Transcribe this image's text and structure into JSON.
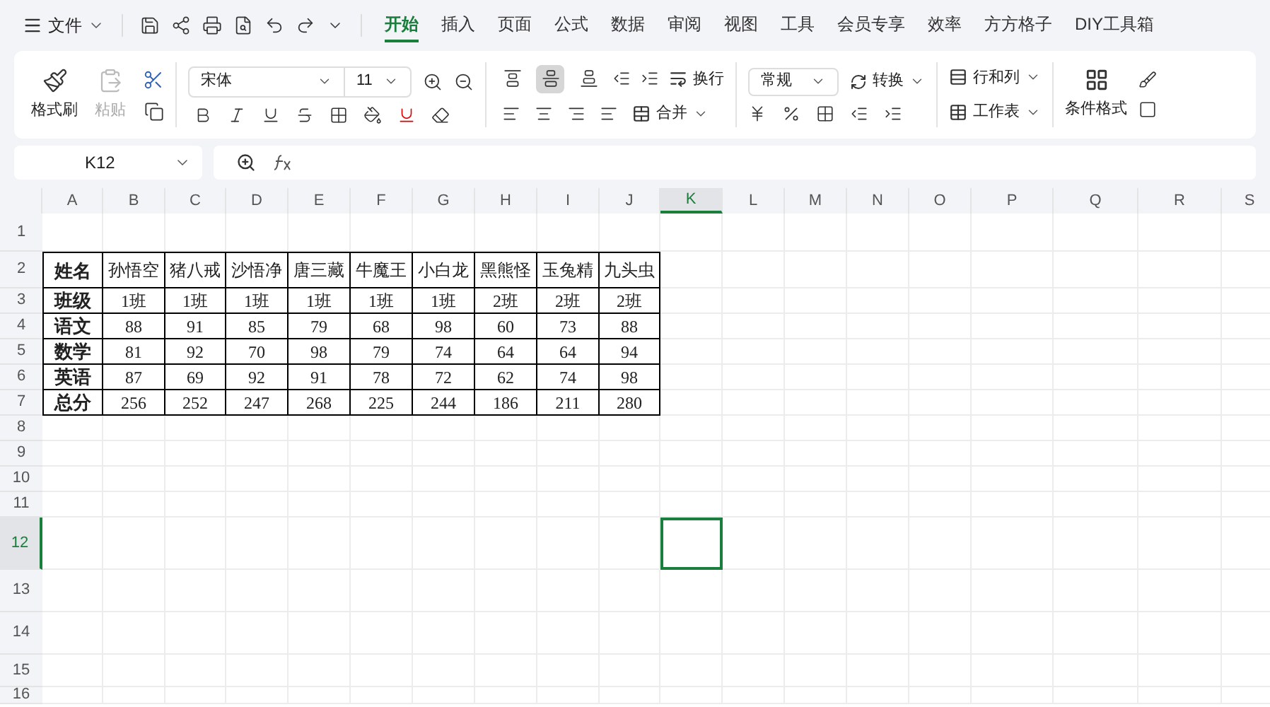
{
  "menu": {
    "label": "文件"
  },
  "tabs": [
    {
      "label": "开始",
      "selected": true
    },
    {
      "label": "插入",
      "selected": false
    },
    {
      "label": "页面",
      "selected": false
    },
    {
      "label": "公式",
      "selected": false
    },
    {
      "label": "数据",
      "selected": false
    },
    {
      "label": "审阅",
      "selected": false
    },
    {
      "label": "视图",
      "selected": false
    },
    {
      "label": "工具",
      "selected": false
    },
    {
      "label": "会员专享",
      "selected": false
    },
    {
      "label": "效率",
      "selected": false
    },
    {
      "label": "方方格子",
      "selected": false
    },
    {
      "label": "DIY工具箱",
      "selected": false
    }
  ],
  "ribbon": {
    "format_painter": "格式刷",
    "paste": {
      "label": "粘贴",
      "disabled": true
    },
    "font_name": "宋体",
    "font_size": "11",
    "vertical_align": [
      {
        "selected": false
      },
      {
        "selected": true
      },
      {
        "selected": false
      }
    ],
    "wrap": "换行",
    "merge": "合并",
    "number_format": "常规",
    "convert": "转换",
    "rows_columns": "行和列",
    "worksheet": "工作表",
    "conditional_format": "条件格式"
  },
  "name_box": "K12",
  "columns": [
    {
      "label": "A",
      "selected": false
    },
    {
      "label": "B",
      "selected": false
    },
    {
      "label": "C",
      "selected": false
    },
    {
      "label": "D",
      "selected": false
    },
    {
      "label": "E",
      "selected": false
    },
    {
      "label": "F",
      "selected": false
    },
    {
      "label": "G",
      "selected": false
    },
    {
      "label": "H",
      "selected": false
    },
    {
      "label": "I",
      "selected": false
    },
    {
      "label": "J",
      "selected": false
    },
    {
      "label": "K",
      "selected": true
    },
    {
      "label": "L",
      "selected": false
    },
    {
      "label": "M",
      "selected": false
    },
    {
      "label": "N",
      "selected": false
    },
    {
      "label": "O",
      "selected": false
    },
    {
      "label": "P",
      "selected": false
    },
    {
      "label": "Q",
      "selected": false
    },
    {
      "label": "R",
      "selected": false
    },
    {
      "label": "S",
      "selected": false
    }
  ],
  "rows": [
    {
      "label": "1",
      "selected": false
    },
    {
      "label": "2",
      "selected": false
    },
    {
      "label": "3",
      "selected": false
    },
    {
      "label": "4",
      "selected": false
    },
    {
      "label": "5",
      "selected": false
    },
    {
      "label": "6",
      "selected": false
    },
    {
      "label": "7",
      "selected": false
    },
    {
      "label": "8",
      "selected": false
    },
    {
      "label": "9",
      "selected": false
    },
    {
      "label": "10",
      "selected": false
    },
    {
      "label": "11",
      "selected": false
    },
    {
      "label": "12",
      "selected": true
    },
    {
      "label": "13",
      "selected": false
    },
    {
      "label": "14",
      "selected": false
    },
    {
      "label": "15",
      "selected": false
    },
    {
      "label": "16",
      "selected": false
    }
  ],
  "table": [
    [
      "姓名",
      "孙悟空",
      "猪八戒",
      "沙悟净",
      "唐三藏",
      "牛魔王",
      "小白龙",
      "黑熊怪",
      "玉兔精",
      "九头虫"
    ],
    [
      "班级",
      "1班",
      "1班",
      "1班",
      "1班",
      "1班",
      "1班",
      "2班",
      "2班",
      "2班"
    ],
    [
      "语文",
      "88",
      "91",
      "85",
      "79",
      "68",
      "98",
      "60",
      "73",
      "88"
    ],
    [
      "数学",
      "81",
      "92",
      "70",
      "98",
      "79",
      "74",
      "64",
      "64",
      "94"
    ],
    [
      "英语",
      "87",
      "69",
      "92",
      "91",
      "78",
      "72",
      "62",
      "74",
      "98"
    ],
    [
      "总分",
      "256",
      "252",
      "247",
      "268",
      "225",
      "244",
      "186",
      "211",
      "280"
    ]
  ]
}
